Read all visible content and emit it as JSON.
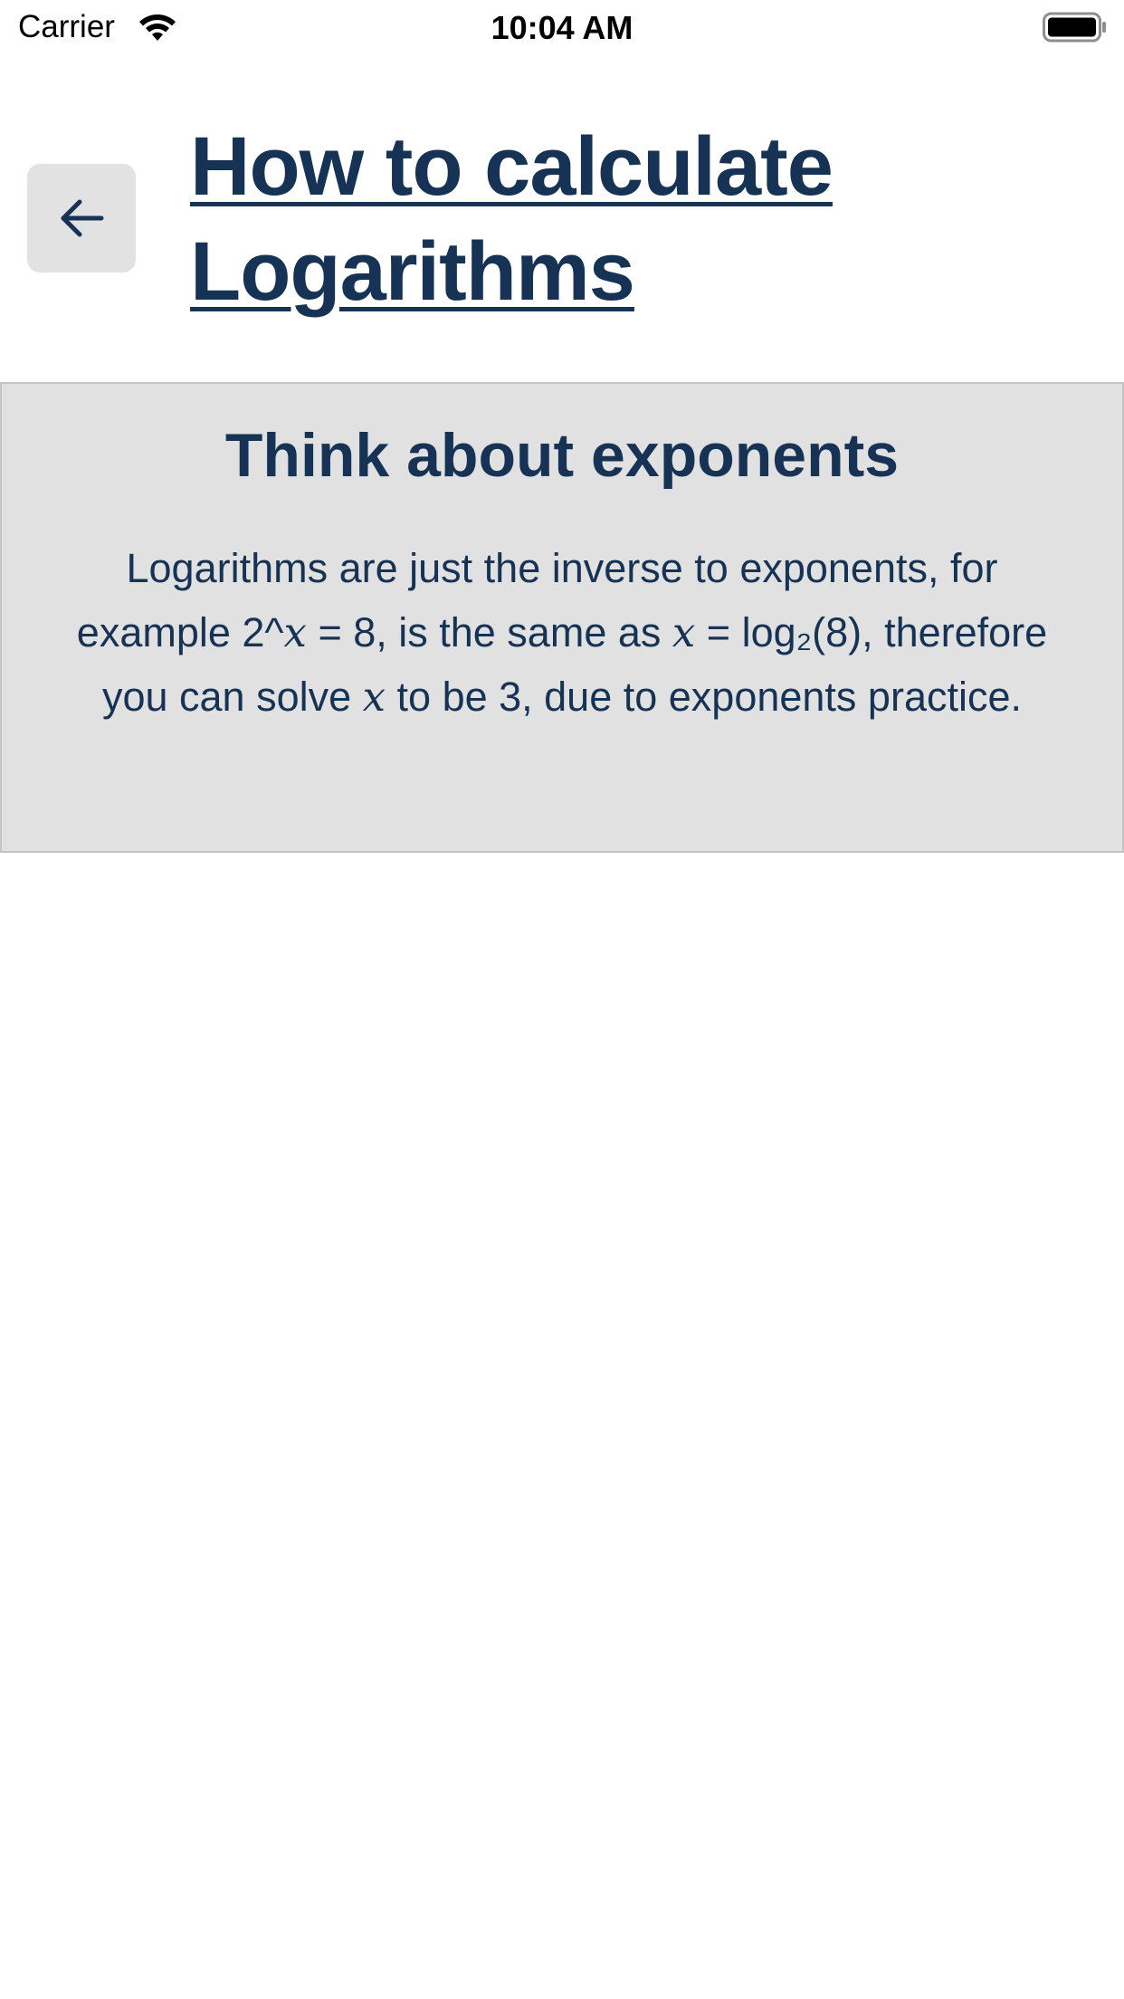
{
  "status_bar": {
    "carrier": "Carrier",
    "time": "10:04 AM"
  },
  "header": {
    "back_icon": "arrow-left-icon",
    "title": "How to calculate Logarithms"
  },
  "card": {
    "title": "Think about exponents",
    "body": {
      "p1": "Logarithms are just the inverse to exponents, for example 2^",
      "var1": "x",
      "p2": " = 8, is the same as ",
      "var2": "x",
      "p3": " = log₂(8), therefore you can solve ",
      "var3": "x",
      "p4": " to be 3, due to exponents practice."
    }
  },
  "colors": {
    "title_text": "#163356",
    "card_background": "#e1e1e1",
    "back_button_background": "#e2e2e2"
  }
}
